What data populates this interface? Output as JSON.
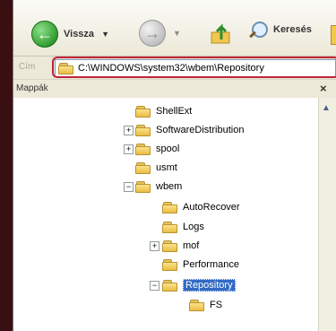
{
  "toolbar": {
    "back_label": "Vissza",
    "search_label": "Keresés"
  },
  "address": {
    "label": "Cím",
    "path": "C:\\WINDOWS\\system32\\wbem\\Repository"
  },
  "pane": {
    "title": "Mappák",
    "close": "×"
  },
  "tree": {
    "items": [
      {
        "label": "ShellExt"
      },
      {
        "label": "SoftwareDistribution"
      },
      {
        "label": "spool"
      },
      {
        "label": "usmt"
      },
      {
        "label": "wbem"
      },
      {
        "label": "AutoRecover"
      },
      {
        "label": "Logs"
      },
      {
        "label": "mof"
      },
      {
        "label": "Performance"
      },
      {
        "label": "Repository"
      },
      {
        "label": "FS"
      }
    ]
  },
  "scroll": {
    "up": "▲"
  }
}
